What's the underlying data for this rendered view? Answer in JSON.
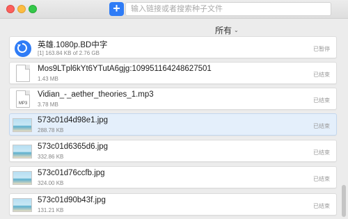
{
  "toolbar": {
    "add_label": "+",
    "search_placeholder": "输入链接或者搜索种子文件"
  },
  "filter": {
    "label": "所有"
  },
  "items": [
    {
      "name": "英雄.1080p.BD中字",
      "meta": "[1] 163.84 KB of 2.76 GB",
      "status": "已暂停",
      "icon": "sync-icon"
    },
    {
      "name": "Mos9LTpl6kYt6YTutA6gjg:109951164248627501",
      "meta": "1.43 MB",
      "status": "已结束",
      "icon": "document-icon"
    },
    {
      "name": "Vidian_-_aether_theories_1.mp3",
      "meta": "3.78 MB",
      "status": "已结束",
      "icon": "mp3-icon",
      "icon_text": "MP3"
    },
    {
      "name": "573c01d4d98e1.jpg",
      "meta": "288.78 KB",
      "status": "已结束",
      "icon": "image-thumbnail",
      "selected": true
    },
    {
      "name": "573c01d6365d6.jpg",
      "meta": "332.86 KB",
      "status": "已结束",
      "icon": "image-thumbnail"
    },
    {
      "name": "573c01d76ccfb.jpg",
      "meta": "324.00 KB",
      "status": "已结束",
      "icon": "image-thumbnail"
    },
    {
      "name": "573c01d90b43f.jpg",
      "meta": "131.21 KB",
      "status": "已结束",
      "icon": "image-thumbnail"
    }
  ]
}
